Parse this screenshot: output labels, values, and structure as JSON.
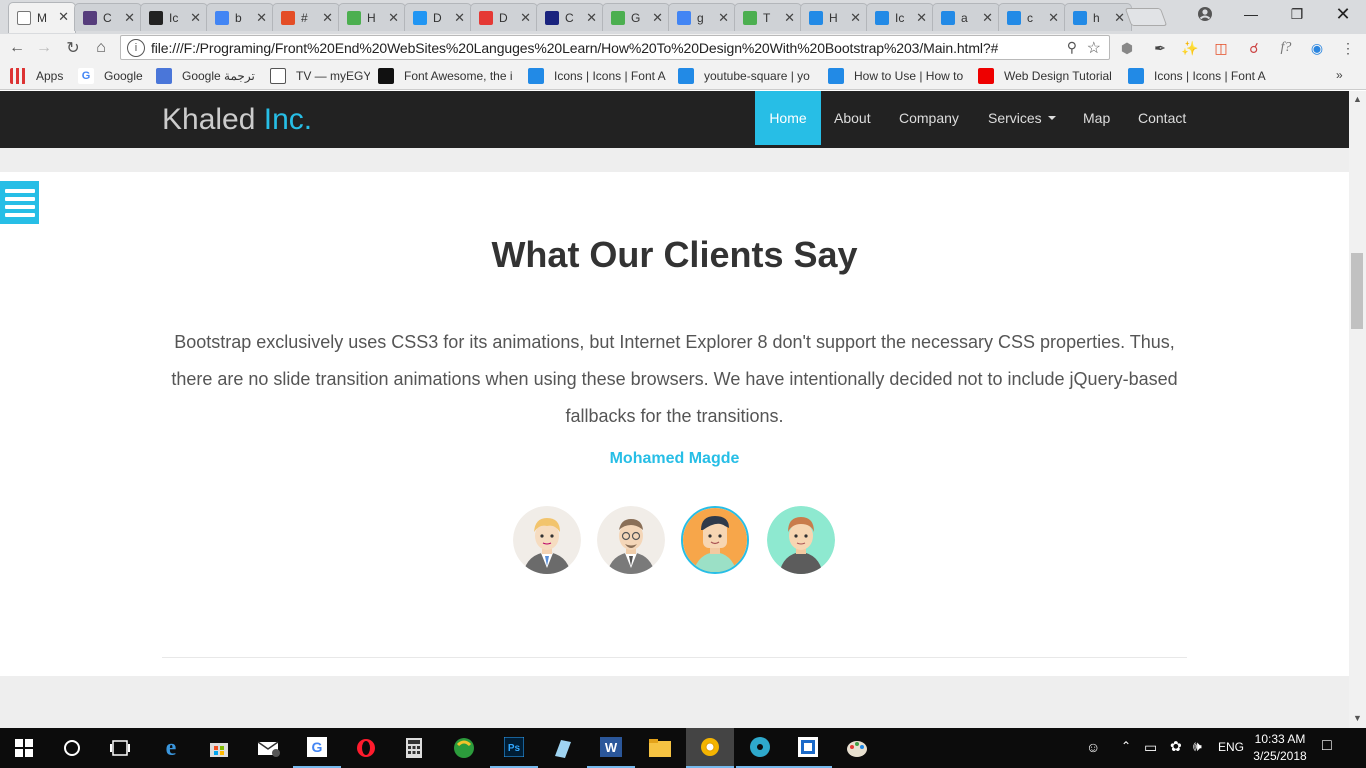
{
  "tabs": [
    {
      "title": "M",
      "fav": "doc",
      "color": "#ffffff",
      "active": true
    },
    {
      "title": "C",
      "fav": "B",
      "color": "#563d7c"
    },
    {
      "title": "Ic",
      "fav": "github",
      "color": "#222222"
    },
    {
      "title": "b",
      "fav": "G",
      "color": "#4285f4"
    },
    {
      "title": "#",
      "fav": "hex",
      "color": "#e44d26"
    },
    {
      "title": "H",
      "fav": "w3",
      "color": "#4caf50"
    },
    {
      "title": "D",
      "fav": "link",
      "color": "#2196f3"
    },
    {
      "title": "D",
      "fav": "f",
      "color": "#e53935"
    },
    {
      "title": "C",
      "fav": "dd",
      "color": "#1a237e"
    },
    {
      "title": "G",
      "fav": "chrome",
      "color": "#4caf50"
    },
    {
      "title": "g",
      "fav": "G",
      "color": "#4285f4"
    },
    {
      "title": "T",
      "fav": "w3",
      "color": "#4caf50"
    },
    {
      "title": "H",
      "fav": "fa",
      "color": "#228ae6"
    },
    {
      "title": "Ic",
      "fav": "fa",
      "color": "#228ae6"
    },
    {
      "title": "a",
      "fav": "fa",
      "color": "#228ae6"
    },
    {
      "title": "c",
      "fav": "fa",
      "color": "#228ae6"
    },
    {
      "title": "h",
      "fav": "fa",
      "color": "#228ae6"
    }
  ],
  "address": {
    "url": "file:///F:/Programing/Front%20End%20WebSites%20Languges%20Learn/How%20To%20Design%20With%20Bootstrap%203/Main.html?#"
  },
  "bookmarks": [
    {
      "label": "Apps",
      "icon": "apps-grid-icon"
    },
    {
      "label": "Google",
      "icon": "google-icon"
    },
    {
      "label": "Google ترجمة",
      "icon": "translate-icon"
    },
    {
      "label": "TV — myEGY",
      "icon": "page-icon"
    },
    {
      "label": "Font Awesome, the i",
      "icon": "flag-icon"
    },
    {
      "label": "Icons | Icons | Font A",
      "icon": "fa-icon"
    },
    {
      "label": "youtube-square | yo",
      "icon": "fa-icon"
    },
    {
      "label": "How to Use | How to",
      "icon": "fa-icon"
    },
    {
      "label": "Web Design Tutorial",
      "icon": "youtube-icon"
    },
    {
      "label": "Icons | Icons | Font A",
      "icon": "fa-icon"
    }
  ],
  "site": {
    "brand_main": "Khaled",
    "brand_accent": "Inc.",
    "nav": [
      "Home",
      "About",
      "Company",
      "Services",
      "Map",
      "Contact"
    ],
    "accent_color": "#27bee6"
  },
  "testimonials": {
    "heading": "What Our Clients Say",
    "quote": "Bootstrap exclusively uses CSS3 for its animations, but Internet Explorer 8 don't support the necessary CSS properties. Thus, there are no slide transition animations when using these browsers. We have intentionally decided not to include jQuery-based fallbacks for the transitions.",
    "author": "Mohamed Magde",
    "avatars": [
      "avatar-blond-man",
      "avatar-glasses-man",
      "avatar-dark-hair-man",
      "avatar-young-man"
    ],
    "selected_index": 2
  },
  "taskbar": {
    "apps": [
      "start",
      "cortana",
      "task-view",
      "edge",
      "store",
      "mail",
      "chrome",
      "opera",
      "calculator",
      "idm",
      "photoshop",
      "notepad",
      "word",
      "explorer",
      "chrome-canary",
      "media",
      "brackets",
      "paint"
    ],
    "language": "ENG",
    "time": "10:33 AM",
    "date": "3/25/2018"
  }
}
